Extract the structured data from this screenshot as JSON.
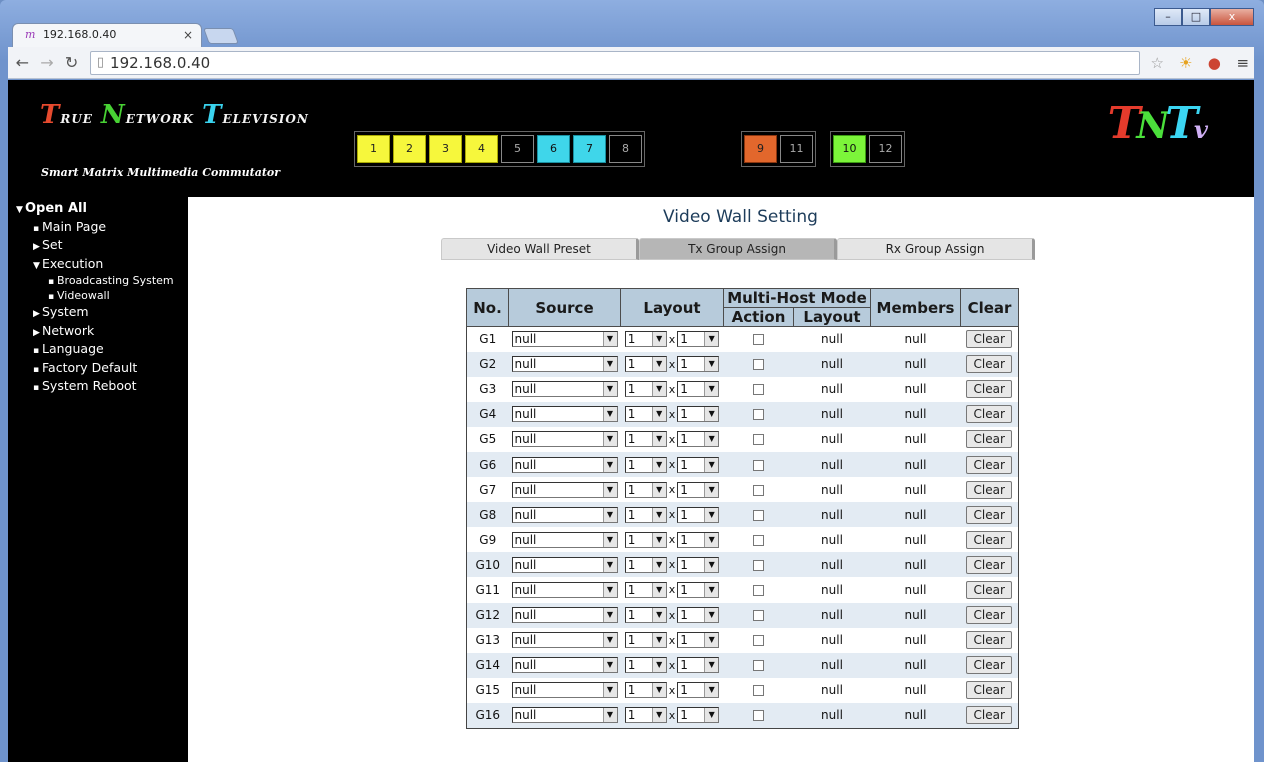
{
  "browser": {
    "tab_title": "192.168.0.40",
    "tab_close": "×",
    "url": "192.168.0.40",
    "win_minimize": "–",
    "win_maximize": "□",
    "win_close": "x"
  },
  "header": {
    "brand_letters": [
      {
        "big": "T",
        "small": "RUE",
        "cls": "t"
      },
      {
        "big": "N",
        "small": "ETWORK",
        "cls": "n"
      },
      {
        "big": "T",
        "small": "ELEVISION",
        "cls": "v"
      }
    ],
    "subtitle": "Smart Matrix Multimedia Commutator",
    "channel_groups": [
      [
        {
          "label": "1",
          "color": "y"
        },
        {
          "label": "2",
          "color": "y"
        },
        {
          "label": "3",
          "color": "y"
        },
        {
          "label": "4",
          "color": "y"
        },
        {
          "label": "5",
          "color": ""
        },
        {
          "label": "6",
          "color": "c"
        },
        {
          "label": "7",
          "color": "c"
        },
        {
          "label": "8",
          "color": ""
        }
      ],
      [
        {
          "label": "9",
          "color": "o"
        },
        {
          "label": "11",
          "color": ""
        }
      ],
      [
        {
          "label": "10",
          "color": "g"
        },
        {
          "label": "12",
          "color": ""
        }
      ]
    ],
    "logo": {
      "l1": "T",
      "l2": "N",
      "l3": "T",
      "l4": "v"
    }
  },
  "sidebar": {
    "items": [
      {
        "label": "Open All",
        "marker": "▼",
        "level": 0
      },
      {
        "label": "Main Page",
        "marker": "▪",
        "level": 1
      },
      {
        "label": "Set",
        "marker": "▶",
        "level": 1
      },
      {
        "label": "Execution",
        "marker": "▼",
        "level": 1
      },
      {
        "label": "Broadcasting System",
        "marker": "▪",
        "level": 2
      },
      {
        "label": "Videowall",
        "marker": "▪",
        "level": 2
      },
      {
        "label": "System",
        "marker": "▶",
        "level": 1
      },
      {
        "label": "Network",
        "marker": "▶",
        "level": 1
      },
      {
        "label": "Language",
        "marker": "▪",
        "level": 1
      },
      {
        "label": "Factory Default",
        "marker": "▪",
        "level": 1
      },
      {
        "label": "System Reboot",
        "marker": "▪",
        "level": 1
      }
    ]
  },
  "main": {
    "title": "Video Wall Setting",
    "tabs": [
      {
        "label": "Video Wall Preset",
        "active": false
      },
      {
        "label": "Tx Group Assign",
        "active": true
      },
      {
        "label": "Rx Group Assign",
        "active": false
      }
    ],
    "table": {
      "headers": {
        "no": "No.",
        "source": "Source",
        "layout": "Layout",
        "multi_host": "Multi-Host Mode",
        "action": "Action",
        "mh_layout": "Layout",
        "members": "Members",
        "clear": "Clear"
      },
      "layout_sep": "x",
      "rows": [
        {
          "no": "G1",
          "source": "null",
          "cols": "1",
          "rows": "1",
          "mh_layout": "null",
          "members": "null",
          "clear": "Clear"
        },
        {
          "no": "G2",
          "source": "null",
          "cols": "1",
          "rows": "1",
          "mh_layout": "null",
          "members": "null",
          "clear": "Clear"
        },
        {
          "no": "G3",
          "source": "null",
          "cols": "1",
          "rows": "1",
          "mh_layout": "null",
          "members": "null",
          "clear": "Clear"
        },
        {
          "no": "G4",
          "source": "null",
          "cols": "1",
          "rows": "1",
          "mh_layout": "null",
          "members": "null",
          "clear": "Clear"
        },
        {
          "no": "G5",
          "source": "null",
          "cols": "1",
          "rows": "1",
          "mh_layout": "null",
          "members": "null",
          "clear": "Clear"
        },
        {
          "no": "G6",
          "source": "null",
          "cols": "1",
          "rows": "1",
          "mh_layout": "null",
          "members": "null",
          "clear": "Clear"
        },
        {
          "no": "G7",
          "source": "null",
          "cols": "1",
          "rows": "1",
          "mh_layout": "null",
          "members": "null",
          "clear": "Clear"
        },
        {
          "no": "G8",
          "source": "null",
          "cols": "1",
          "rows": "1",
          "mh_layout": "null",
          "members": "null",
          "clear": "Clear"
        },
        {
          "no": "G9",
          "source": "null",
          "cols": "1",
          "rows": "1",
          "mh_layout": "null",
          "members": "null",
          "clear": "Clear"
        },
        {
          "no": "G10",
          "source": "null",
          "cols": "1",
          "rows": "1",
          "mh_layout": "null",
          "members": "null",
          "clear": "Clear"
        },
        {
          "no": "G11",
          "source": "null",
          "cols": "1",
          "rows": "1",
          "mh_layout": "null",
          "members": "null",
          "clear": "Clear"
        },
        {
          "no": "G12",
          "source": "null",
          "cols": "1",
          "rows": "1",
          "mh_layout": "null",
          "members": "null",
          "clear": "Clear"
        },
        {
          "no": "G13",
          "source": "null",
          "cols": "1",
          "rows": "1",
          "mh_layout": "null",
          "members": "null",
          "clear": "Clear"
        },
        {
          "no": "G14",
          "source": "null",
          "cols": "1",
          "rows": "1",
          "mh_layout": "null",
          "members": "null",
          "clear": "Clear"
        },
        {
          "no": "G15",
          "source": "null",
          "cols": "1",
          "rows": "1",
          "mh_layout": "null",
          "members": "null",
          "clear": "Clear"
        },
        {
          "no": "G16",
          "source": "null",
          "cols": "1",
          "rows": "1",
          "mh_layout": "null",
          "members": "null",
          "clear": "Clear"
        }
      ]
    }
  }
}
